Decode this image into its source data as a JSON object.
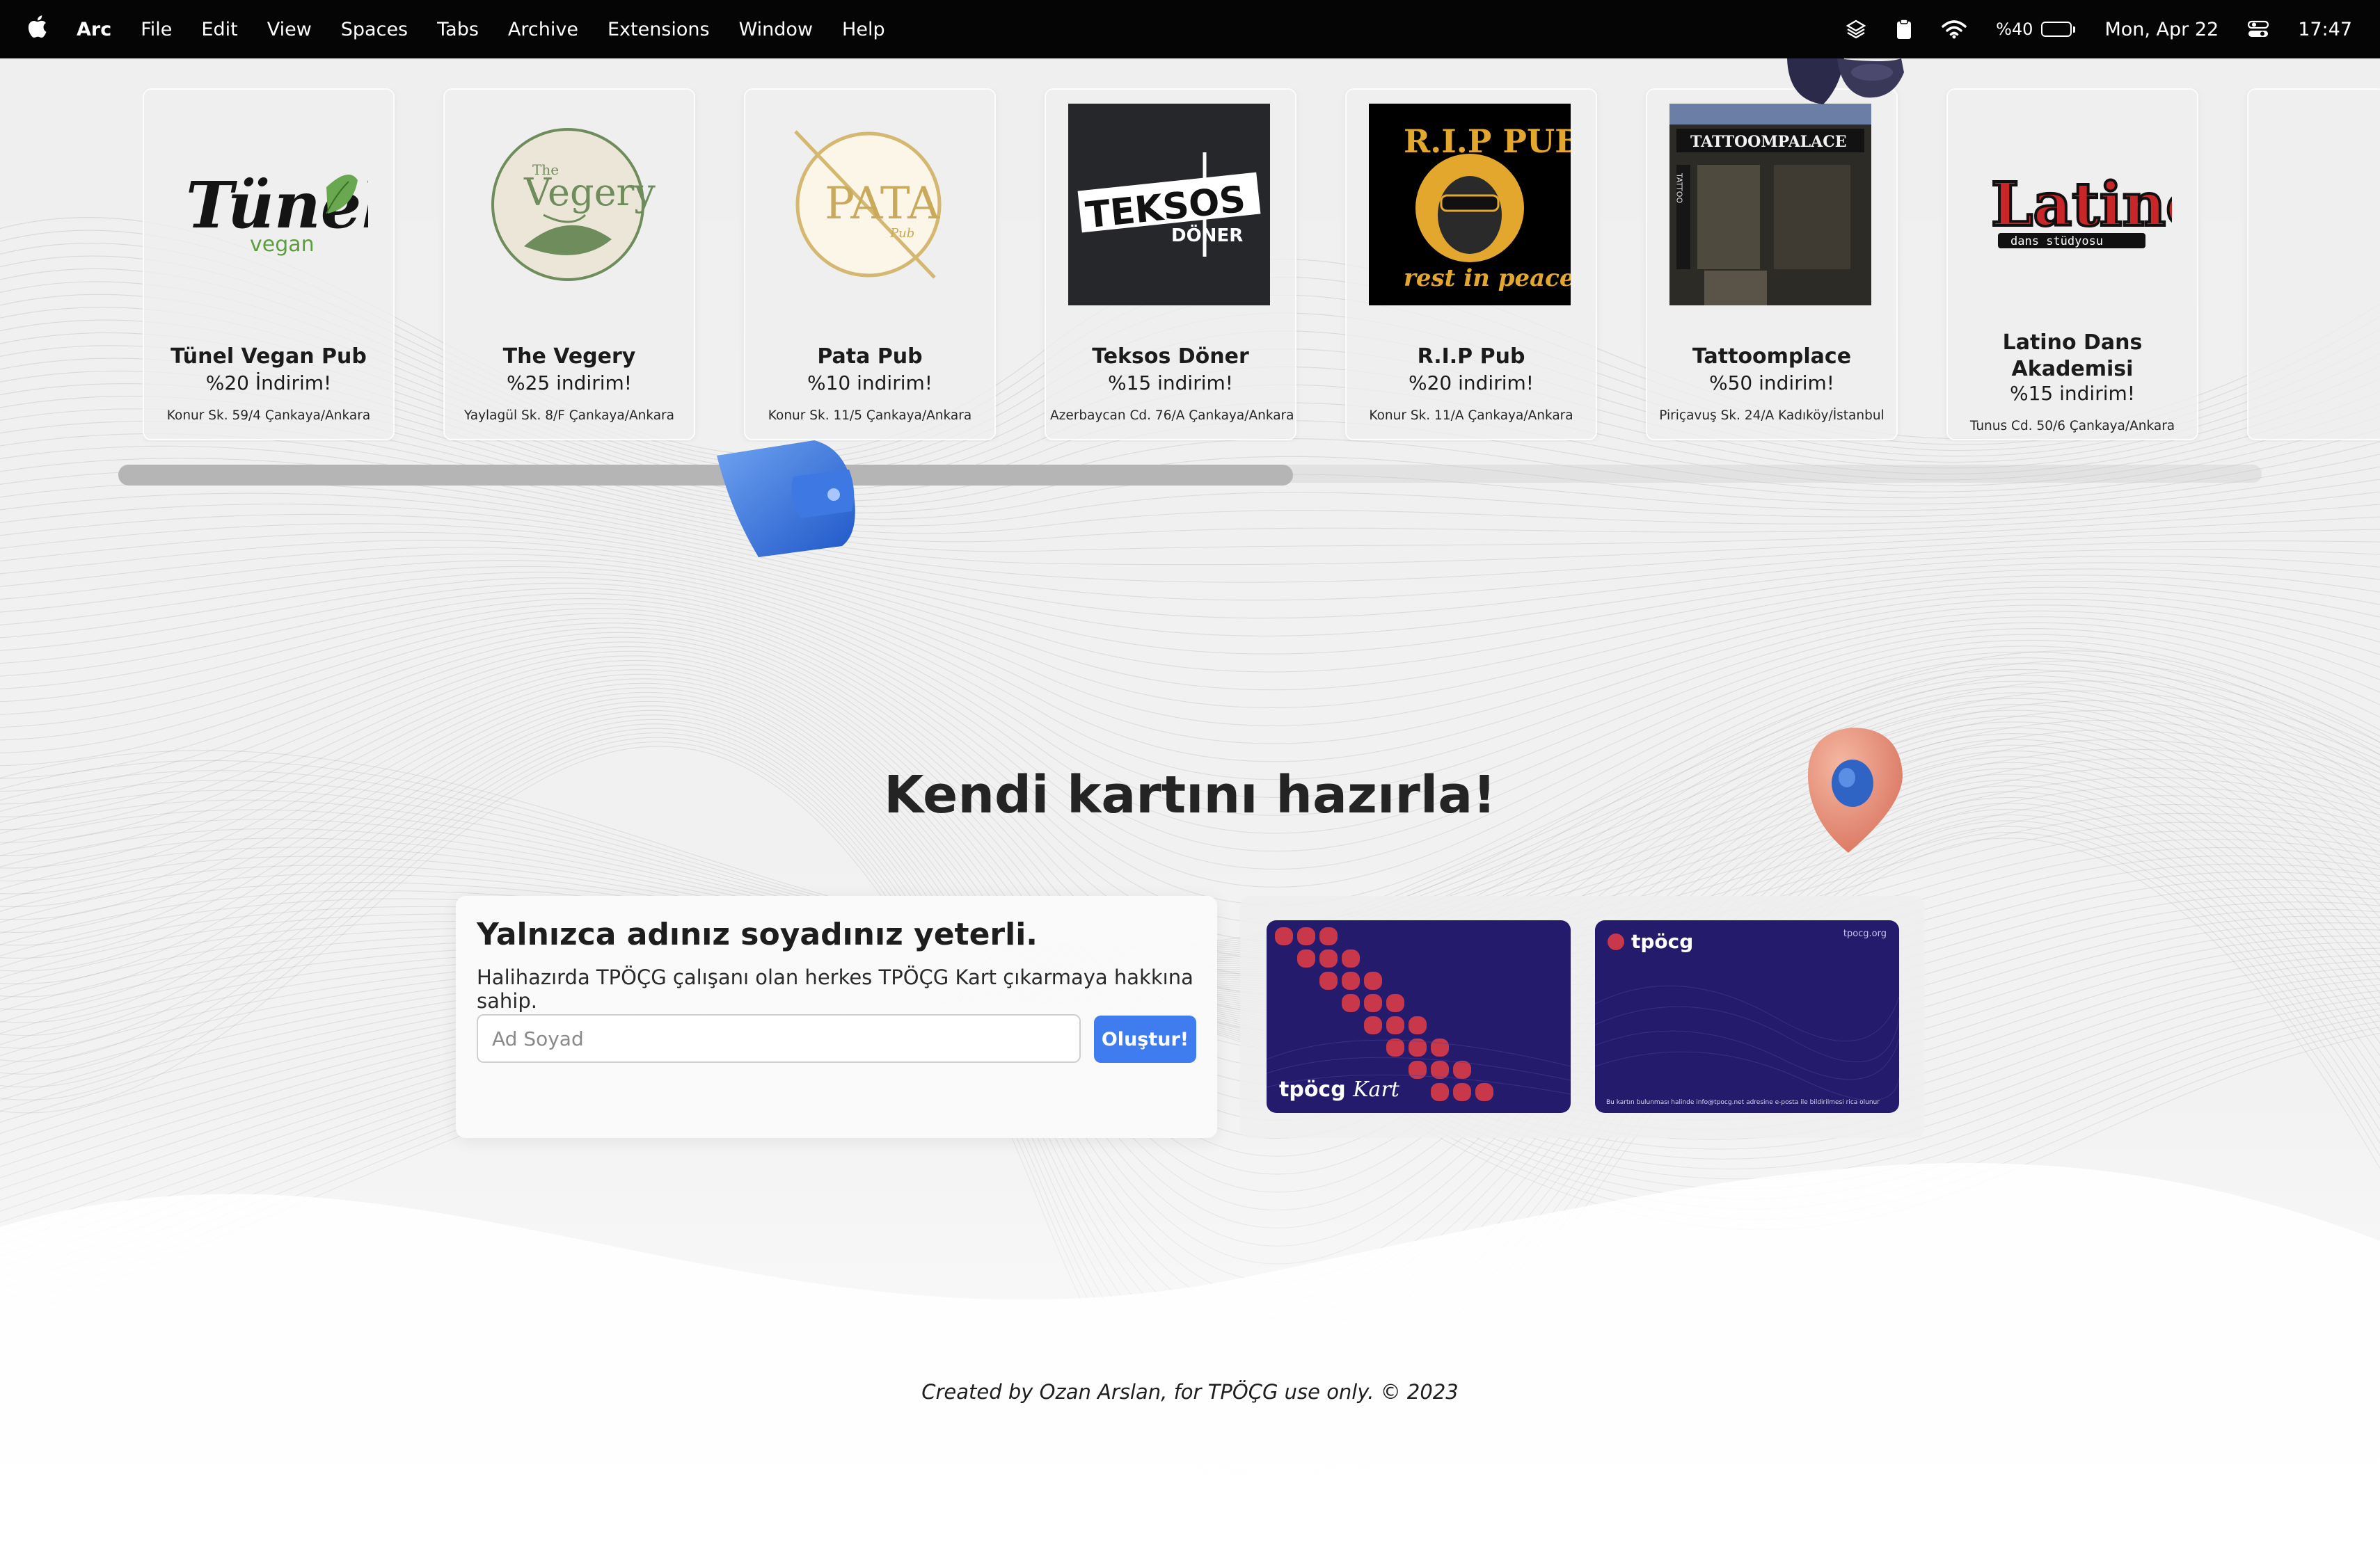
{
  "menubar": {
    "app_name": "Arc",
    "items": [
      "File",
      "Edit",
      "View",
      "Spaces",
      "Tabs",
      "Archive",
      "Extensions",
      "Window",
      "Help"
    ],
    "battery_percent_label": "%40",
    "battery_level": 0.4,
    "date": "Mon, Apr 22",
    "time": "17:47"
  },
  "partners": [
    {
      "name": "Tünel Vegan Pub",
      "discount": "%20 İndirim!",
      "address": "Konur Sk. 59/4 Çankaya/Ankara",
      "logo_text": "Tünel",
      "logo_sub": "vegan"
    },
    {
      "name": "The Vegery",
      "discount": "%25 indirim!",
      "address": "Yaylagül Sk. 8/F Çankaya/Ankara",
      "logo_text": "Vegery",
      "logo_sub": "The"
    },
    {
      "name": "Pata Pub",
      "discount": "%10 indirim!",
      "address": "Konur Sk. 11/5 Çankaya/Ankara",
      "logo_text": "PATA",
      "logo_sub": "Pub"
    },
    {
      "name": "Teksos Döner",
      "discount": "%15 indirim!",
      "address": "Azerbaycan Cd. 76/A Çankaya/Ankara",
      "logo_text": "TEKSOS",
      "logo_sub": "DÖNER"
    },
    {
      "name": "R.I.P Pub",
      "discount": "%20 indirim!",
      "address": "Konur Sk. 11/A Çankaya/Ankara",
      "logo_text": "R.I.P PUB",
      "logo_sub": "rest in peace"
    },
    {
      "name": "Tattoomplace",
      "discount": "%50 indirim!",
      "address": "Piriçavuş Sk. 24/A Kadıköy/İstanbul",
      "logo_text": "TATTOOMPALACE",
      "logo_sub": "TATTOO"
    },
    {
      "name": "Latino Dans Akademisi",
      "discount": "%15 indirim!",
      "address": "Tunus Cd. 50/6 Çankaya/Ankara",
      "logo_text": "Latino",
      "logo_sub": "dans stüdyosu"
    }
  ],
  "create": {
    "title": "Kendi kartını hazırla!",
    "heading": "Yalnızca adınız soyadınız yeterli.",
    "description": "Halihazırda TPÖÇG çalışanı olan herkes TPÖÇG Kart çıkarmaya hakkına sahip.",
    "input_placeholder": "Ad Soyad",
    "input_value": "",
    "button_label": "Oluştur!"
  },
  "card_preview": {
    "front_brand": "tpöcg",
    "front_script": "Kart",
    "back_brand": "tpöcg",
    "back_url": "tpocg.org",
    "back_note": "Bu kartın bulunması halinde info@tpocg.net adresine e-posta ile bildirilmesi rica olunur"
  },
  "footer": "Created by Ozan Arslan, for TPÖÇG use only. © 2023",
  "colors": {
    "button": "#3f7cf0",
    "card_bg": "#241b6c",
    "card_dots": "#c9384a"
  }
}
